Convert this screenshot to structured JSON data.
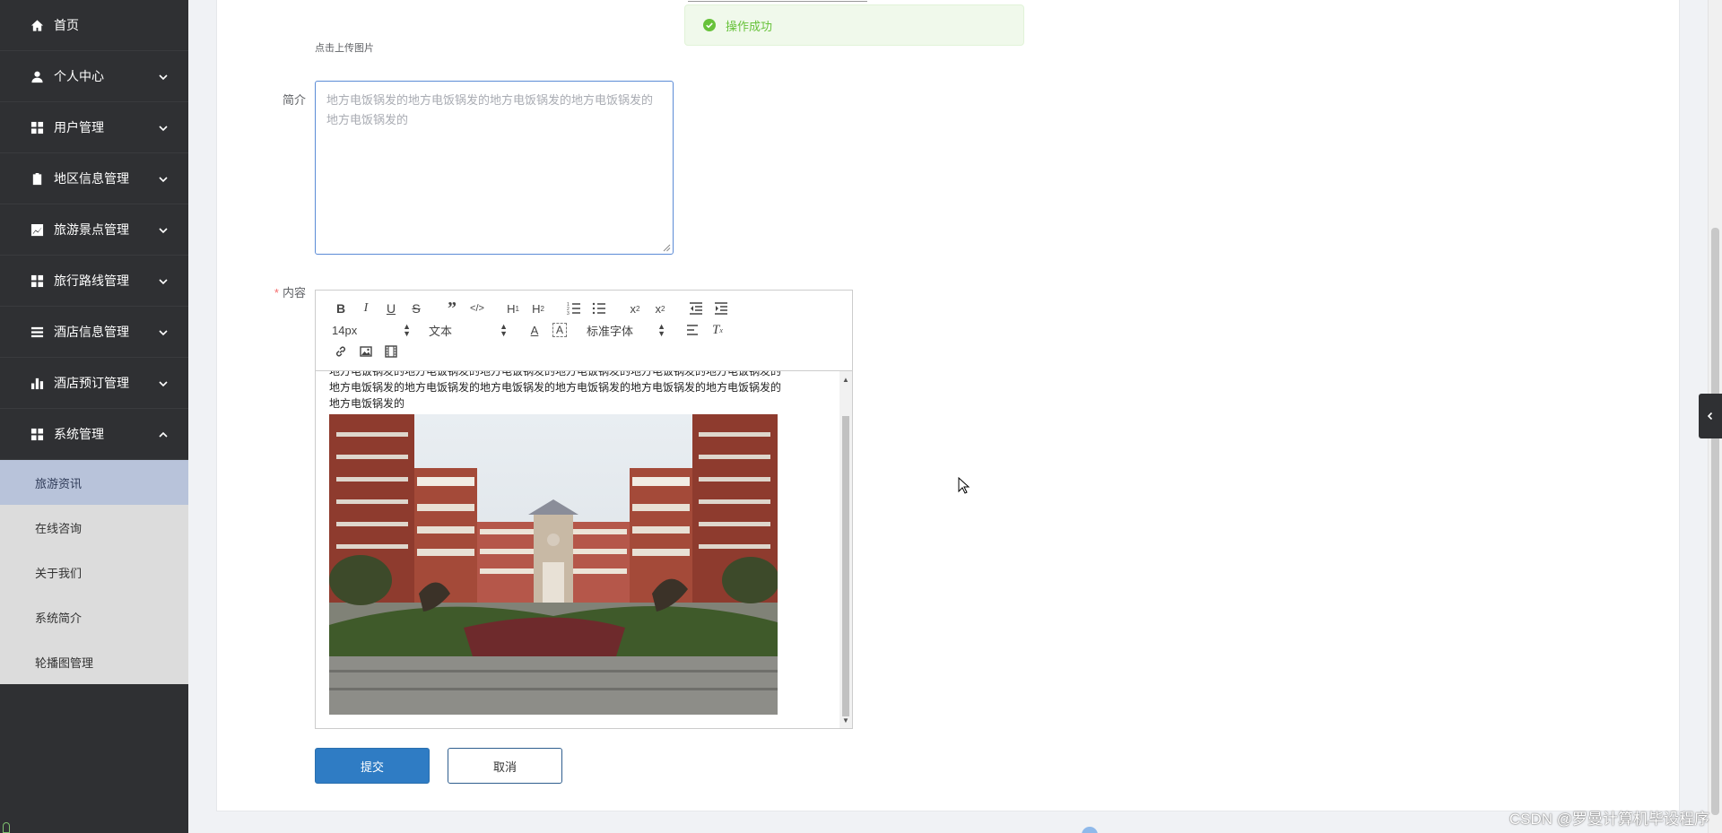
{
  "sidebar": {
    "items": [
      {
        "label": "首页",
        "icon": "home-icon",
        "expandable": false
      },
      {
        "label": "个人中心",
        "icon": "user-icon",
        "expandable": true
      },
      {
        "label": "用户管理",
        "icon": "grid-icon",
        "expandable": true
      },
      {
        "label": "地区信息管理",
        "icon": "clipboard-icon",
        "expandable": true
      },
      {
        "label": "旅游景点管理",
        "icon": "chart-icon",
        "expandable": true
      },
      {
        "label": "旅行路线管理",
        "icon": "grid-icon",
        "expandable": true
      },
      {
        "label": "酒店信息管理",
        "icon": "list-icon",
        "expandable": true
      },
      {
        "label": "酒店预订管理",
        "icon": "bar-chart-icon",
        "expandable": true
      },
      {
        "label": "系统管理",
        "icon": "grid-icon",
        "expandable": true,
        "expanded": true
      }
    ],
    "submenu": [
      {
        "label": "旅游资讯",
        "active": true
      },
      {
        "label": "在线咨询",
        "active": false
      },
      {
        "label": "关于我们",
        "active": false
      },
      {
        "label": "系统简介",
        "active": false
      },
      {
        "label": "轮播图管理",
        "active": false
      }
    ]
  },
  "form": {
    "upload_hint": "点击上传图片",
    "intro_label": "简介",
    "intro_value": "地方电饭锅发的地方电饭锅发的地方电饭锅发的地方电饭锅发的地方电饭锅发的",
    "content_label": "内容",
    "content_required_mark": "*"
  },
  "editor": {
    "toolbar": {
      "font_size": "14px",
      "paragraph": "文本",
      "font_family": "标准字体",
      "buttons": [
        "bold",
        "italic",
        "underline",
        "strike",
        "blockquote",
        "code-block",
        "header-1",
        "header-2",
        "ordered-list",
        "bullet-list",
        "subscript",
        "superscript",
        "outdent",
        "indent",
        "font-color",
        "background-color",
        "align",
        "clean",
        "link",
        "image",
        "video"
      ]
    },
    "text_line0": "地方电饭锅发的地方电饭锅发的地方电饭锅发的地方电饭锅发的地方电饭锅发的地方电饭锅发的",
    "text_line1": "地方电饭锅发的地方电饭锅发的地方电饭锅发的地方电饭锅发的地方电饭锅发的地方电饭锅发的",
    "text_line2": "地方电饭锅发的"
  },
  "buttons": {
    "submit": "提交",
    "cancel": "取消"
  },
  "toast": {
    "message": "操作成功",
    "type": "success",
    "color": "#67c23a"
  },
  "watermark": "CSDN @罗曼计算机毕设程序",
  "colors": {
    "sidebar_bg": "#2f3033",
    "submenu_bg": "#dcdcdc",
    "submenu_active": "#b8c3da",
    "primary": "#2f7cc4"
  }
}
